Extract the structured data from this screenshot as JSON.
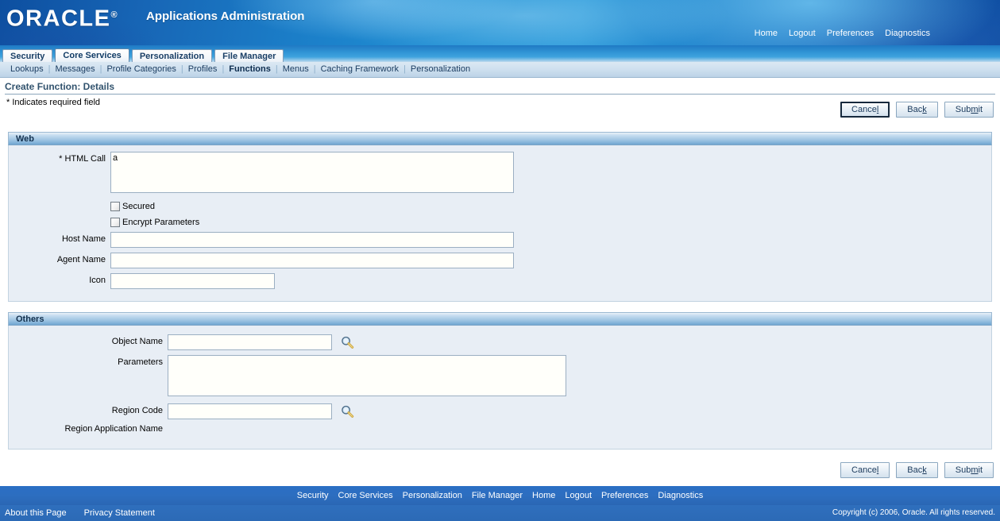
{
  "branding": {
    "logo_text": "ORACLE",
    "logo_reg": "®",
    "app_title": "Applications Administration",
    "global_links": [
      {
        "label": "Home"
      },
      {
        "label": "Logout"
      },
      {
        "label": "Preferences"
      },
      {
        "label": "Diagnostics"
      }
    ]
  },
  "tabs": [
    {
      "label": "Security",
      "selected": false
    },
    {
      "label": "Core Services",
      "selected": true
    },
    {
      "label": "Personalization",
      "selected": false
    },
    {
      "label": "File Manager",
      "selected": false
    }
  ],
  "subtabs": [
    {
      "label": "Lookups",
      "selected": false
    },
    {
      "label": "Messages",
      "selected": false
    },
    {
      "label": "Profile Categories",
      "selected": false
    },
    {
      "label": "Profiles",
      "selected": false
    },
    {
      "label": "Functions",
      "selected": true
    },
    {
      "label": "Menus",
      "selected": false
    },
    {
      "label": "Caching Framework",
      "selected": false
    },
    {
      "label": "Personalization",
      "selected": false
    }
  ],
  "page": {
    "title": "Create Function: Details",
    "required_note_star": "*",
    "required_note": "Indicates required field"
  },
  "actions": {
    "cancel": {
      "pre": "Cance",
      "acc": "l",
      "post": ""
    },
    "back": {
      "pre": "Bac",
      "acc": "k",
      "post": ""
    },
    "submit": {
      "pre": "Sub",
      "acc": "m",
      "post": "it"
    }
  },
  "web_section": {
    "heading": "Web",
    "html_call": {
      "label_star": "*",
      "label": "HTML Call",
      "value": "a",
      "placeholder": ""
    },
    "secured": {
      "label": "Secured",
      "checked": false
    },
    "encrypt_parameters": {
      "label": "Encrypt Parameters",
      "checked": false
    },
    "host_name": {
      "label": "Host Name",
      "value": "",
      "placeholder": ""
    },
    "agent_name": {
      "label": "Agent Name",
      "value": "",
      "placeholder": ""
    },
    "icon": {
      "label": "Icon",
      "value": "",
      "placeholder": ""
    }
  },
  "others_section": {
    "heading": "Others",
    "object_name": {
      "label": "Object Name",
      "value": "",
      "placeholder": "",
      "lov_icon": "search-icon"
    },
    "parameters": {
      "label": "Parameters",
      "value": "",
      "placeholder": ""
    },
    "region_code": {
      "label": "Region Code",
      "value": "",
      "placeholder": "",
      "lov_icon": "search-icon"
    },
    "region_application_name": {
      "label": "Region Application Name",
      "value": ""
    }
  },
  "footer": {
    "links": [
      {
        "label": "Security"
      },
      {
        "label": "Core Services"
      },
      {
        "label": "Personalization"
      },
      {
        "label": "File Manager"
      },
      {
        "label": "Home"
      },
      {
        "label": "Logout"
      },
      {
        "label": "Preferences"
      },
      {
        "label": "Diagnostics"
      }
    ],
    "about": "About this Page",
    "privacy": "Privacy Statement",
    "copyright": "Copyright (c) 2006, Oracle. All rights reserved."
  },
  "colors": {
    "brand_blue": "#1b7ec8",
    "footer_blue": "#2d6ec0",
    "panel_bg": "#e8eef5",
    "section_head": "#9ec4e2",
    "title_text": "#32536e"
  }
}
